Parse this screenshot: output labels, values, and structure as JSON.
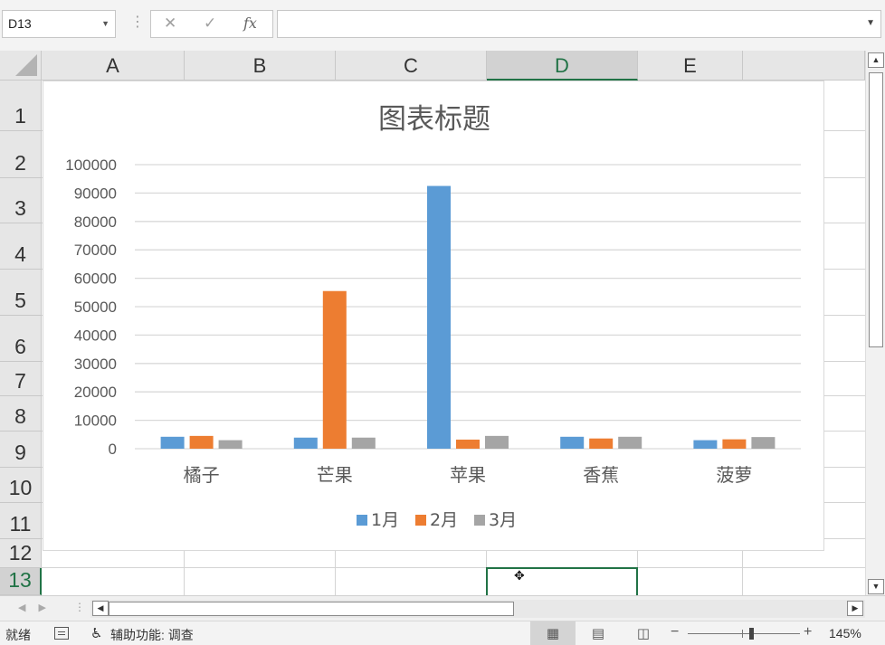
{
  "formula_bar": {
    "name_box": "D13",
    "cancel_icon": "✕",
    "enter_icon": "✓",
    "fx_label": "fx",
    "formula_value": ""
  },
  "columns": [
    {
      "label": "A",
      "selected": false
    },
    {
      "label": "B",
      "selected": false
    },
    {
      "label": "C",
      "selected": false
    },
    {
      "label": "D",
      "selected": true
    },
    {
      "label": "E",
      "selected": false
    }
  ],
  "rows": [
    {
      "label": "1"
    },
    {
      "label": "2"
    },
    {
      "label": "3"
    },
    {
      "label": "4"
    },
    {
      "label": "5"
    },
    {
      "label": "6"
    },
    {
      "label": "7"
    },
    {
      "label": "8"
    },
    {
      "label": "9"
    },
    {
      "label": "10"
    },
    {
      "label": "11"
    },
    {
      "label": "12"
    },
    {
      "label": "13",
      "selected": true
    }
  ],
  "chart_data": {
    "type": "bar",
    "title": "图表标题",
    "categories": [
      "橘子",
      "芒果",
      "苹果",
      "香蕉",
      "菠萝"
    ],
    "series": [
      {
        "name": "1月",
        "color": "#5b9bd5",
        "values": [
          4200,
          3900,
          92500,
          4200,
          3000
        ]
      },
      {
        "name": "2月",
        "color": "#ed7d31",
        "values": [
          4500,
          55500,
          3200,
          3600,
          3300
        ]
      },
      {
        "name": "3月",
        "color": "#a5a5a5",
        "values": [
          3000,
          3900,
          4500,
          4200,
          4100
        ]
      }
    ],
    "ylim": [
      0,
      100000
    ],
    "yticks": [
      "0",
      "10000",
      "20000",
      "30000",
      "40000",
      "50000",
      "60000",
      "70000",
      "80000",
      "90000",
      "100000"
    ],
    "xlabel": "",
    "ylabel": "",
    "grid": true,
    "legend": "bottom"
  },
  "status_bar": {
    "ready": "就绪",
    "accessibility": "辅助功能: 调查",
    "zoom_minus": "−",
    "zoom_plus": "+",
    "zoom_level": "145%"
  }
}
